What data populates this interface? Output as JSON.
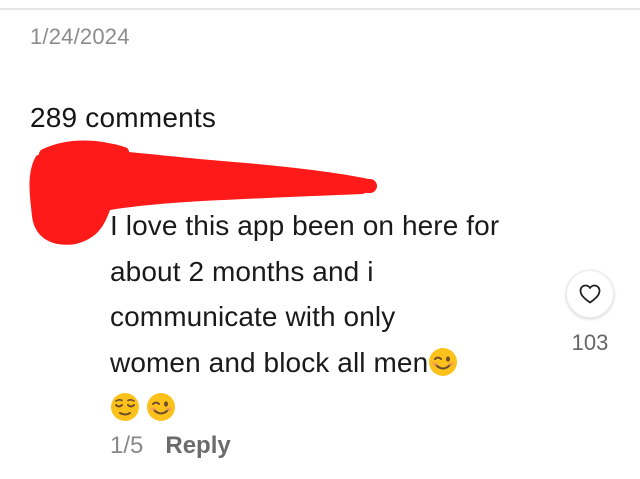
{
  "post": {
    "date": "1/24/2024"
  },
  "comments_header": {
    "label": "289 comments"
  },
  "comment": {
    "lines": [
      "I love this app been on here for",
      "about 2 months and i",
      "communicate with only",
      "women and block all men"
    ],
    "trailing_emoji": "winking-face-emoji",
    "extra_emojis": [
      "relieved-face-emoji",
      "winking-face-emoji"
    ],
    "like_icon": "heart-outline-icon",
    "like_count": "103",
    "page_indicator": "1/5",
    "reply_label": "Reply"
  },
  "colors": {
    "redaction": "#ff1a1a",
    "emoji_face": "#fcc21b",
    "text": "#1a1a1a",
    "muted_text": "#8a8a8a"
  }
}
